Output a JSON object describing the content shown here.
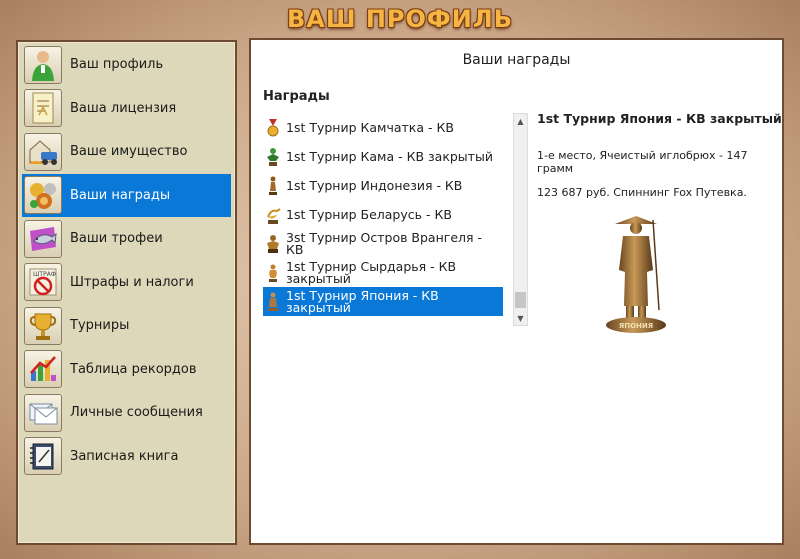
{
  "header": {
    "title": "ВАШ ПРОФИЛЬ"
  },
  "sidebar": {
    "items": [
      {
        "label": "Ваш профиль",
        "icon": "user-icon",
        "active": false
      },
      {
        "label": "Ваша лицензия",
        "icon": "license-icon",
        "active": false
      },
      {
        "label": "Ваше имущество",
        "icon": "property-icon",
        "active": false
      },
      {
        "label": "Ваши награды",
        "icon": "medals-icon",
        "active": true
      },
      {
        "label": "Ваши трофеи",
        "icon": "fish-trophy-icon",
        "active": false
      },
      {
        "label": "Штрафы и налоги",
        "icon": "fines-icon",
        "active": false
      },
      {
        "label": "Турниры",
        "icon": "cup-icon",
        "active": false
      },
      {
        "label": "Таблица рекордов",
        "icon": "records-chart-icon",
        "active": false
      },
      {
        "label": "Личные сообщения",
        "icon": "messages-icon",
        "active": false
      },
      {
        "label": "Записная книга",
        "icon": "notebook-icon",
        "active": false
      }
    ]
  },
  "main": {
    "title": "Ваши награды",
    "section_label": "Награды",
    "awards": [
      {
        "label": "1st Турнир Камчатка - КВ",
        "icon": "medal-icon",
        "selected": false
      },
      {
        "label": "1st Турнир Кама - КВ закрытый",
        "icon": "award-figure-icon",
        "selected": false
      },
      {
        "label": "1st Турнир Индонезия - КВ",
        "icon": "statuette-icon",
        "selected": false
      },
      {
        "label": "1st Турнир Беларусь - КВ",
        "icon": "stork-trophy-icon",
        "selected": false
      },
      {
        "label": "3st Турнир Остров Врангеля - КВ",
        "icon": "figure-trophy-icon",
        "selected": false
      },
      {
        "label": "1st Турнир Сырдарья - КВ закрытый",
        "icon": "vase-trophy-icon",
        "selected": false
      },
      {
        "label": "1st Турнир Япония - КВ закрытый",
        "icon": "samurai-trophy-icon",
        "selected": true
      }
    ],
    "detail": {
      "title": "1st Турнир Япония - КВ закрытый",
      "description": "1-е место, Ячеистый иглобрюх - 147 грамм",
      "prize": "123 687 руб. Спиннинг Fox Путевка.",
      "trophy_icon": "samurai-statue-icon",
      "trophy_label": "ЯПОНИЯ"
    }
  },
  "colors": {
    "accent": "#0a78d7",
    "sidebar_bg": "#ddd8b9",
    "frame": "#6f4a33",
    "title": "#f6b443"
  }
}
